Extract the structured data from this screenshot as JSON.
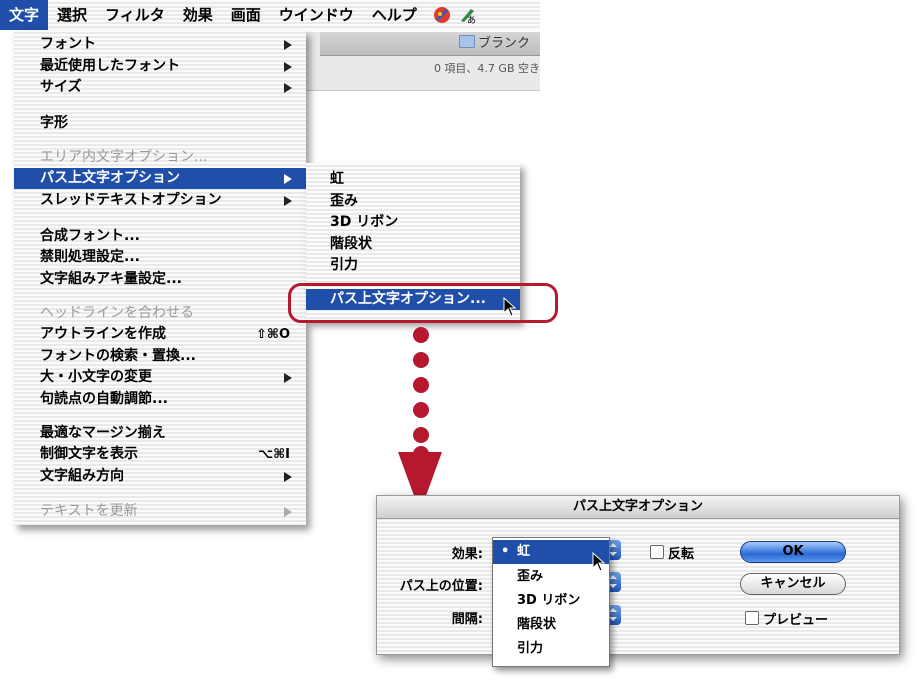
{
  "menubar": {
    "items": [
      "文字",
      "選択",
      "フィルタ",
      "効果",
      "画面",
      "ウインドウ",
      "ヘルプ"
    ],
    "active_index": 0
  },
  "finder": {
    "title": "ブランク",
    "status": "0 項目、4.7 GB 空き"
  },
  "main_menu": {
    "items": [
      {
        "label": "フォント",
        "submenu": true
      },
      {
        "label": "最近使用したフォント",
        "submenu": true
      },
      {
        "label": "サイズ",
        "submenu": true
      },
      {
        "label": "字形"
      },
      {
        "label": "エリア内文字オプション...",
        "disabled": true
      },
      {
        "label": "パス上文字オプション",
        "submenu": true,
        "selected": true
      },
      {
        "label": "スレッドテキストオプション",
        "submenu": true
      },
      {
        "label": "合成フォント..."
      },
      {
        "label": "禁則処理設定..."
      },
      {
        "label": "文字組みアキ量設定..."
      },
      {
        "label": "ヘッドラインを合わせる",
        "disabled": true
      },
      {
        "label": "アウトラインを作成",
        "shortcut": "⇧⌘O"
      },
      {
        "label": "フォントの検索・置換..."
      },
      {
        "label": "大・小文字の変更",
        "submenu": true
      },
      {
        "label": "句読点の自動調節..."
      },
      {
        "label": "最適なマージン揃え"
      },
      {
        "label": "制御文字を表示",
        "shortcut": "⌥⌘I"
      },
      {
        "label": "文字組み方向",
        "submenu": true
      },
      {
        "label": "テキストを更新",
        "submenu": true,
        "disabled": true
      }
    ]
  },
  "sub_menu": {
    "items": [
      {
        "label": "虹"
      },
      {
        "label": "歪み"
      },
      {
        "label": "3D リボン"
      },
      {
        "label": "階段状"
      },
      {
        "label": "引力"
      },
      {
        "label": "パス上文字オプション...",
        "selected": true
      }
    ]
  },
  "dialog": {
    "title": "パス上文字オプション",
    "effect_label": "効果:",
    "position_label": "パス上の位置:",
    "spacing_label": "間隔:",
    "flip_label": "反転",
    "preview_label": "プレビュー",
    "ok_label": "OK",
    "cancel_label": "キャンセル",
    "effect_options": [
      "虹",
      "歪み",
      "3D リボン",
      "階段状",
      "引力"
    ],
    "effect_selected": "虹",
    "bullet": "•"
  },
  "colors": {
    "accent": "#1f4fa8",
    "highlight_ring": "#b5182f"
  }
}
